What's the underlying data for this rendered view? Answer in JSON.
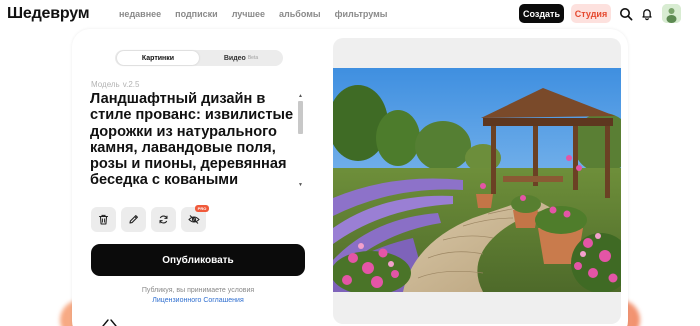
{
  "header": {
    "logo": "Шедеврум",
    "nav": [
      "недавнее",
      "подписки",
      "лучшее",
      "альбомы",
      "фильтрумы"
    ],
    "create_label": "Создать",
    "studio_label": "Студия",
    "icons": [
      "search-icon",
      "bell-icon",
      "avatar"
    ]
  },
  "mode_toggle": {
    "pictures_label": "Картинки",
    "video_label": "Видео",
    "video_badge": "Beta",
    "selected": "Картинки"
  },
  "model": {
    "label": "Модель",
    "version": "v.2.5"
  },
  "prompt": {
    "text": "Ландшафтный дизайн в стиле прованс: извилистые дорожки из натурального камня, лавандовые поля, розы и пионы, деревянная беседка с коваными элементами"
  },
  "tools": {
    "icons": [
      "trash-icon",
      "pencil-icon",
      "refresh-icon",
      "eye-off-icon"
    ],
    "pro_badge": "PRO"
  },
  "publish": {
    "label": "Опубликовать"
  },
  "terms": {
    "text": "Публикуя, вы принимаете условия",
    "link": "Лицензионного Соглашения"
  },
  "colors": {
    "accent": "#e5492f",
    "button_dark": "#0b0b0b",
    "link": "#2f6fd0"
  }
}
